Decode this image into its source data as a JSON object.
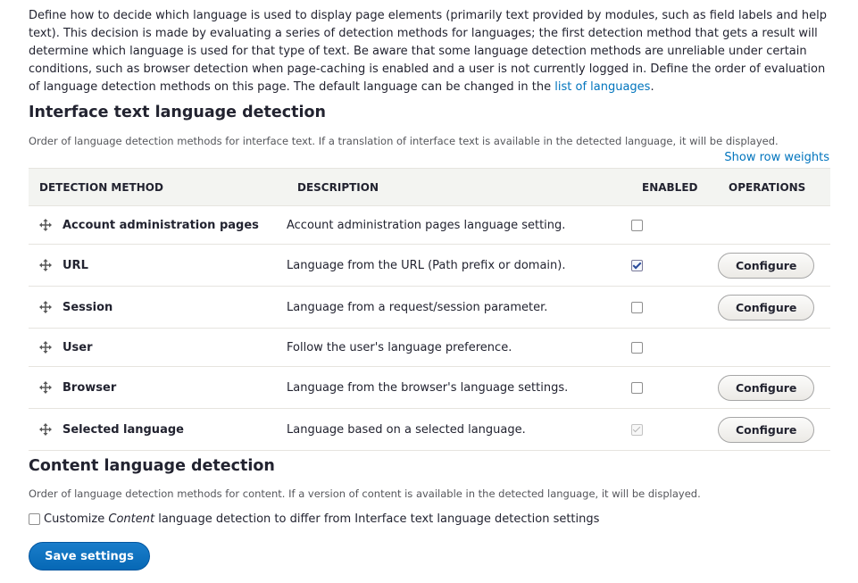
{
  "intro": {
    "text": "Define how to decide which language is used to display page elements (primarily text provided by modules, such as field labels and help text). This decision is made by evaluating a series of detection methods for languages; the first detection method that gets a result will determine which language is used for that type of text. Be aware that some language detection methods are unreliable under certain conditions, such as browser detection when page-caching is enabled and a user is not currently logged in. Define the order of evaluation of language detection methods on this page. The default language can be changed in the ",
    "link": "list of languages",
    "tail": "."
  },
  "interface": {
    "title": "Interface text language detection",
    "description": "Order of language detection methods for interface text. If a translation of interface text is available in the detected language, it will be displayed.",
    "weights_link": "Show row weights",
    "columns": {
      "method": "DETECTION METHOD",
      "description": "DESCRIPTION",
      "enabled": "ENABLED",
      "operations": "OPERATIONS"
    },
    "rows": [
      {
        "method": "Account administration pages",
        "description": "Account administration pages language setting.",
        "enabled": false,
        "operation": ""
      },
      {
        "method": "URL",
        "description": "Language from the URL (Path prefix or domain).",
        "enabled": true,
        "operation": "Configure"
      },
      {
        "method": "Session",
        "description": "Language from a request/session parameter.",
        "enabled": false,
        "operation": "Configure"
      },
      {
        "method": "User",
        "description": "Follow the user's language preference.",
        "enabled": false,
        "operation": ""
      },
      {
        "method": "Browser",
        "description": "Language from the browser's language settings.",
        "enabled": false,
        "operation": "Configure"
      },
      {
        "method": "Selected language",
        "description": "Language based on a selected language.",
        "enabled": true,
        "disabled": true,
        "operation": "Configure"
      }
    ]
  },
  "content": {
    "title": "Content language detection",
    "description": "Order of language detection methods for content. If a version of content is available in the detected language, it will be displayed.",
    "customize_prefix": "Customize ",
    "customize_em": "Content",
    "customize_suffix": " language detection to differ from Interface text language detection settings",
    "customize_checked": false
  },
  "save_label": "Save settings"
}
